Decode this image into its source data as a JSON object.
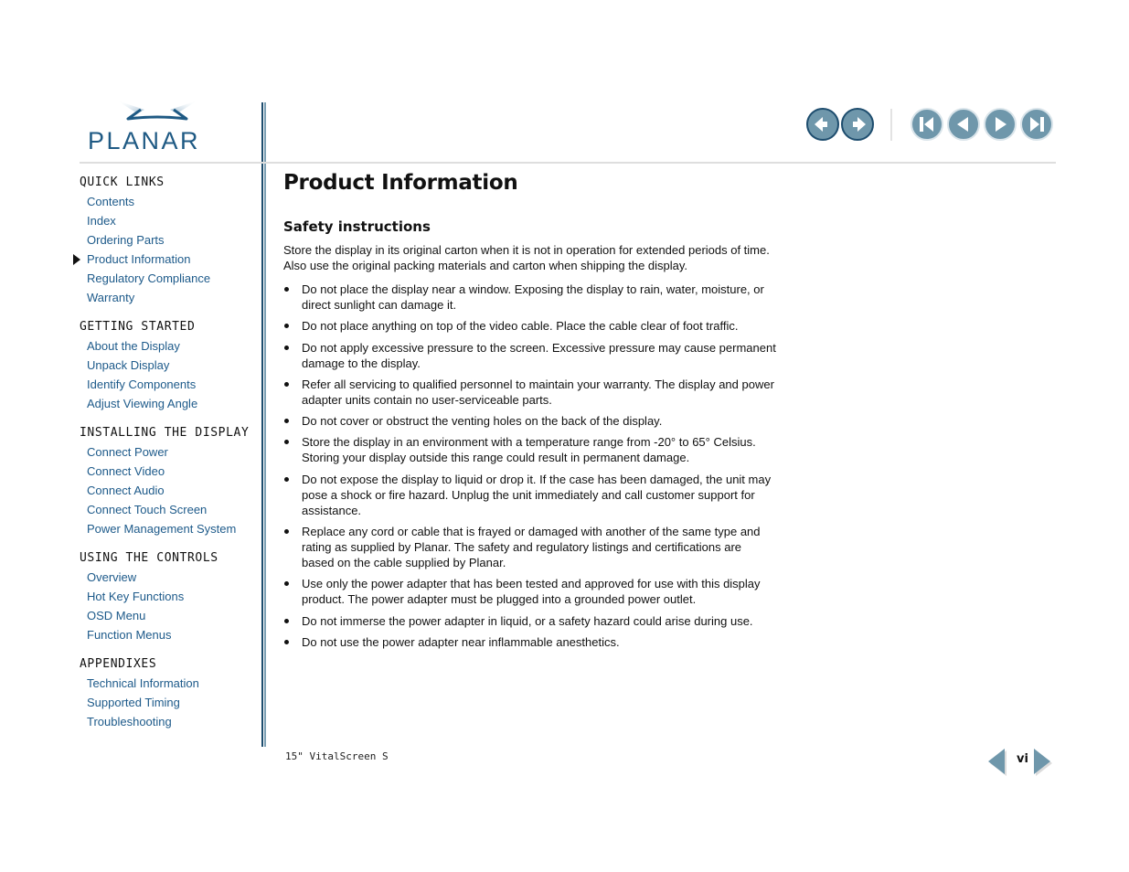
{
  "brand": {
    "logo_text": "PLANAR",
    "accent_color": "#1d5a8a",
    "button_color": "#6f97ab"
  },
  "toolbar": {
    "history": [
      {
        "name": "back",
        "icon": "history-back-icon"
      },
      {
        "name": "forward",
        "icon": "history-forward-icon"
      }
    ],
    "paging": [
      {
        "name": "first-page",
        "icon": "first-page-icon"
      },
      {
        "name": "previous-page",
        "icon": "previous-page-icon"
      },
      {
        "name": "next-page",
        "icon": "next-page-icon"
      },
      {
        "name": "last-page",
        "icon": "last-page-icon"
      }
    ]
  },
  "sidebar": {
    "sections": [
      {
        "title": "QUICK LINKS",
        "items": [
          "Contents",
          "Index",
          "Ordering Parts",
          "Product Information",
          "Regulatory Compliance",
          "Warranty"
        ]
      },
      {
        "title": "GETTING STARTED",
        "items": [
          "About the Display",
          "Unpack Display",
          "Identify Components",
          "Adjust Viewing Angle"
        ]
      },
      {
        "title": "INSTALLING THE DISPLAY",
        "items": [
          "Connect Power",
          "Connect Video",
          "Connect Audio",
          "Connect Touch Screen",
          "Power Management System"
        ]
      },
      {
        "title": "USING THE CONTROLS",
        "items": [
          "Overview",
          "Hot Key Functions",
          "OSD Menu",
          "Function Menus"
        ]
      },
      {
        "title": "APPENDIXES",
        "items": [
          "Technical Information",
          "Supported Timing",
          "Troubleshooting"
        ]
      }
    ],
    "active_item": "Product Information"
  },
  "main": {
    "title": "Product Information",
    "section_heading": "Safety instructions",
    "intro": "Store the display in its original  carton when it is not in operation for extended periods of time. Also use the original packing materials and carton when shipping the display.",
    "bullets": [
      "Do not place the display near a window. Exposing the display to rain, water, moisture, or direct sunlight can damage it.",
      "Do not place anything on top of the video cable. Place the cable clear of foot traffic.",
      "Do not apply excessive pressure to the screen. Excessive pressure may cause permanent damage to the display.",
      "Refer all servicing to qualified personnel to maintain your warranty. The display and power adapter units contain no user-serviceable parts.",
      "Do not cover or obstruct the venting holes on the back of the display.",
      "Store the display in an environment with a temperature range from -20° to 65° Celsius. Storing your display outside this range could result in permanent damage.",
      "Do not expose the display to liquid or drop it. If the case has been damaged, the unit may pose a shock or fire hazard. Unplug the unit immediately and call customer support for assistance.",
      "Replace any cord or cable that is frayed or damaged with another of the same type and rating as supplied by Planar. The safety and regulatory listings and certifications are based on the cable supplied by Planar.",
      "Use only the power adapter that has been tested and approved for use with this display product. The power adapter must be plugged into a grounded power outlet.",
      "Do not immerse the power adapter in liquid, or a safety hazard could arise during use.",
      "Do not use the power adapter near inflammable anesthetics."
    ]
  },
  "footer": {
    "product_name": "15\" VitalScreen S",
    "page_number": "vi"
  }
}
